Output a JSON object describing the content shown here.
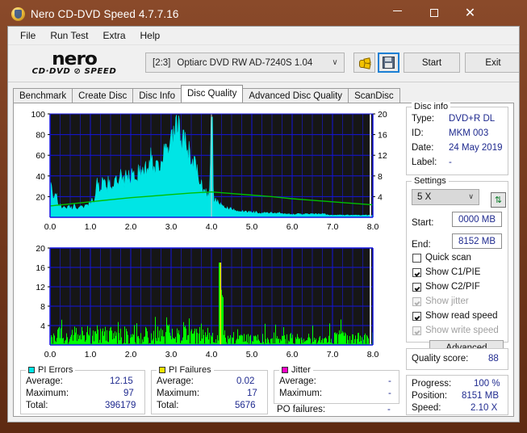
{
  "window": {
    "title": "Nero CD-DVD Speed 4.7.7.16",
    "icon": "nero-disc-icon",
    "minimize": "–",
    "maximize": "□",
    "close": "✕",
    "frame_color": "#7a3d20"
  },
  "menu": [
    "File",
    "Run Test",
    "Extra",
    "Help"
  ],
  "toolbar": {
    "logo_word": "nero",
    "logo_sub": "CD·DVD ⊘ SPEED",
    "drive_index": "[2:3]",
    "drive_name": "Optiarc DVD RW AD-7240S 1.04",
    "caret": "∨",
    "plug_button": "plug-icon",
    "save_button": "floppy-disk-icon",
    "start_label": "Start",
    "exit_label": "Exit"
  },
  "tabs": [
    {
      "label": "Benchmark",
      "active": false
    },
    {
      "label": "Create Disc",
      "active": false
    },
    {
      "label": "Disc Info",
      "active": false
    },
    {
      "label": "Disc Quality",
      "active": true
    },
    {
      "label": "Advanced Disc Quality",
      "active": false
    },
    {
      "label": "ScanDisc",
      "active": false
    }
  ],
  "disc_info": {
    "title": "Disc info",
    "type_label": "Type:",
    "type_value": "DVD+R DL",
    "id_label": "ID:",
    "id_value": "MKM 003",
    "date_label": "Date:",
    "date_value": "24 May 2019",
    "label_label": "Label:",
    "label_value": "-"
  },
  "settings": {
    "title": "Settings",
    "speed_value": "5 X",
    "caret": "∨",
    "refresh_icon": "refresh-icon",
    "start_label": "Start:",
    "start_value": "0000 MB",
    "end_label": "End:",
    "end_value": "8152 MB",
    "checks": [
      {
        "label": "Quick scan",
        "checked": false,
        "disabled": false
      },
      {
        "label": "Show C1/PIE",
        "checked": true,
        "disabled": false
      },
      {
        "label": "Show C2/PIF",
        "checked": true,
        "disabled": false
      },
      {
        "label": "Show jitter",
        "checked": true,
        "disabled": true
      },
      {
        "label": "Show read speed",
        "checked": true,
        "disabled": false
      },
      {
        "label": "Show write speed",
        "checked": true,
        "disabled": true
      }
    ],
    "advanced_label": "Advanced"
  },
  "quality": {
    "label": "Quality score:",
    "value": "88"
  },
  "progress": {
    "progress_label": "Progress:",
    "progress_value": "100 %",
    "position_label": "Position:",
    "position_value": "8151 MB",
    "speed_label": "Speed:",
    "speed_value": "2.10 X"
  },
  "stats": {
    "pi_errors": {
      "title": "PI Errors",
      "color": "#00e5e5",
      "rows": [
        {
          "label": "Average:",
          "value": "12.15"
        },
        {
          "label": "Maximum:",
          "value": "97"
        },
        {
          "label": "Total:",
          "value": "396179"
        }
      ]
    },
    "pi_failures": {
      "title": "PI Failures",
      "color": "#f2e500",
      "rows": [
        {
          "label": "Average:",
          "value": "0.02"
        },
        {
          "label": "Maximum:",
          "value": "17"
        },
        {
          "label": "Total:",
          "value": "5676"
        }
      ]
    },
    "jitter": {
      "title": "Jitter",
      "color": "#ff00c8",
      "rows": [
        {
          "label": "Average:",
          "value": "-"
        },
        {
          "label": "Maximum:",
          "value": "-"
        }
      ],
      "po_label": "PO failures:",
      "po_value": "-"
    }
  },
  "chart_data": [
    {
      "type": "area",
      "name": "PI Errors (C1/PIE) scan graph",
      "title": "",
      "xlabel": "",
      "ylabel": "",
      "xlim": [
        0.0,
        8.0
      ],
      "ylim": [
        0,
        100
      ],
      "ylim_right": [
        0,
        20
      ],
      "xticks": [
        "0.0",
        "1.0",
        "2.0",
        "3.0",
        "4.0",
        "5.0",
        "6.0",
        "7.0",
        "8.0"
      ],
      "yticks_left": [
        20,
        40,
        60,
        80,
        100
      ],
      "yticks_right": [
        4,
        8,
        12,
        16,
        20
      ],
      "grid": true,
      "plot_bg": "#161616",
      "grid_color": "#1414e0",
      "series": [
        {
          "name": "PI Errors",
          "color": "#00e5e5",
          "fill": true,
          "x": [
            0.0,
            0.05,
            0.1,
            0.15,
            0.2,
            0.25,
            0.3,
            0.35,
            0.4,
            0.45,
            0.5,
            0.55,
            0.6,
            0.65,
            0.7,
            0.75,
            0.8,
            0.85,
            0.9,
            0.95,
            1.0,
            1.05,
            1.1,
            1.15,
            1.2,
            1.25,
            1.3,
            1.35,
            1.4,
            1.45,
            1.5,
            1.55,
            1.6,
            1.65,
            1.7,
            1.75,
            1.8,
            1.85,
            1.9,
            1.95,
            2.0,
            2.05,
            2.1,
            2.15,
            2.2,
            2.25,
            2.3,
            2.35,
            2.4,
            2.45,
            2.5,
            2.55,
            2.6,
            2.65,
            2.7,
            2.75,
            2.8,
            2.85,
            2.9,
            2.95,
            3.0,
            3.05,
            3.1,
            3.15,
            3.2,
            3.25,
            3.3,
            3.35,
            3.4,
            3.45,
            3.5,
            3.55,
            3.6,
            3.65,
            3.7,
            3.75,
            3.8,
            3.85,
            3.9,
            3.95,
            4.0,
            4.05,
            4.1,
            4.15,
            4.2,
            4.25,
            4.3,
            4.35,
            4.4,
            4.45,
            4.5,
            4.55,
            4.6,
            4.65,
            4.7,
            4.75,
            4.8,
            4.85,
            4.9,
            4.95,
            5.0,
            5.1,
            5.2,
            5.3,
            5.4,
            5.5,
            5.6,
            5.7,
            5.8,
            5.9,
            6.0,
            6.1,
            6.2,
            6.3,
            6.4,
            6.5,
            6.6,
            6.7,
            6.8,
            6.9,
            7.0,
            7.1,
            7.2,
            7.3,
            7.4,
            7.5,
            7.6,
            7.7,
            7.8,
            7.9,
            8.0
          ],
          "y": [
            36,
            22,
            15,
            26,
            13,
            11,
            9,
            12,
            8,
            10,
            9,
            8,
            11,
            9,
            8,
            12,
            10,
            9,
            13,
            12,
            14,
            16,
            15,
            32,
            30,
            28,
            33,
            30,
            27,
            34,
            31,
            29,
            36,
            33,
            31,
            38,
            36,
            33,
            41,
            38,
            36,
            43,
            40,
            38,
            45,
            42,
            40,
            47,
            44,
            42,
            66,
            48,
            46,
            52,
            50,
            55,
            58,
            62,
            60,
            65,
            70,
            74,
            78,
            85,
            80,
            76,
            72,
            68,
            64,
            60,
            56,
            52,
            48,
            42,
            36,
            30,
            26,
            24,
            22,
            20,
            95,
            18,
            16,
            14,
            12,
            11,
            10,
            9,
            9,
            8,
            8,
            7,
            7,
            6,
            6,
            6,
            5,
            5,
            5,
            5,
            5,
            5,
            4,
            4,
            4,
            4,
            4,
            4,
            3,
            3,
            3,
            3,
            3,
            3,
            3,
            3,
            3,
            3,
            3,
            2,
            2,
            2,
            2,
            2,
            2,
            2,
            2,
            2,
            2,
            2,
            2
          ]
        },
        {
          "name": "Read speed",
          "color": "#00c000",
          "fill": false,
          "x": [
            0.0,
            0.5,
            1.0,
            1.5,
            2.0,
            2.5,
            3.0,
            3.5,
            4.0,
            4.5,
            5.0,
            5.5,
            6.0,
            6.5,
            7.0,
            7.5,
            8.0
          ],
          "y_right": [
            2.2,
            2.6,
            3.0,
            3.4,
            3.8,
            4.1,
            4.4,
            4.7,
            4.9,
            4.6,
            4.3,
            4.0,
            3.6,
            3.3,
            3.0,
            2.7,
            2.4
          ]
        }
      ]
    },
    {
      "type": "bar",
      "name": "PI Failures (C2/PIF) scan graph",
      "title": "",
      "xlabel": "",
      "ylabel": "",
      "xlim": [
        0.0,
        8.0
      ],
      "ylim": [
        0,
        20
      ],
      "xticks": [
        "0.0",
        "1.0",
        "2.0",
        "3.0",
        "4.0",
        "5.0",
        "6.0",
        "7.0",
        "8.0"
      ],
      "yticks": [
        4,
        8,
        12,
        16,
        20
      ],
      "grid": true,
      "plot_bg": "#161616",
      "grid_color": "#1414e0",
      "series": [
        {
          "name": "PI Failures",
          "color": "#00ff00",
          "peak_x": 4.2,
          "peak_y": 17
        }
      ]
    }
  ]
}
